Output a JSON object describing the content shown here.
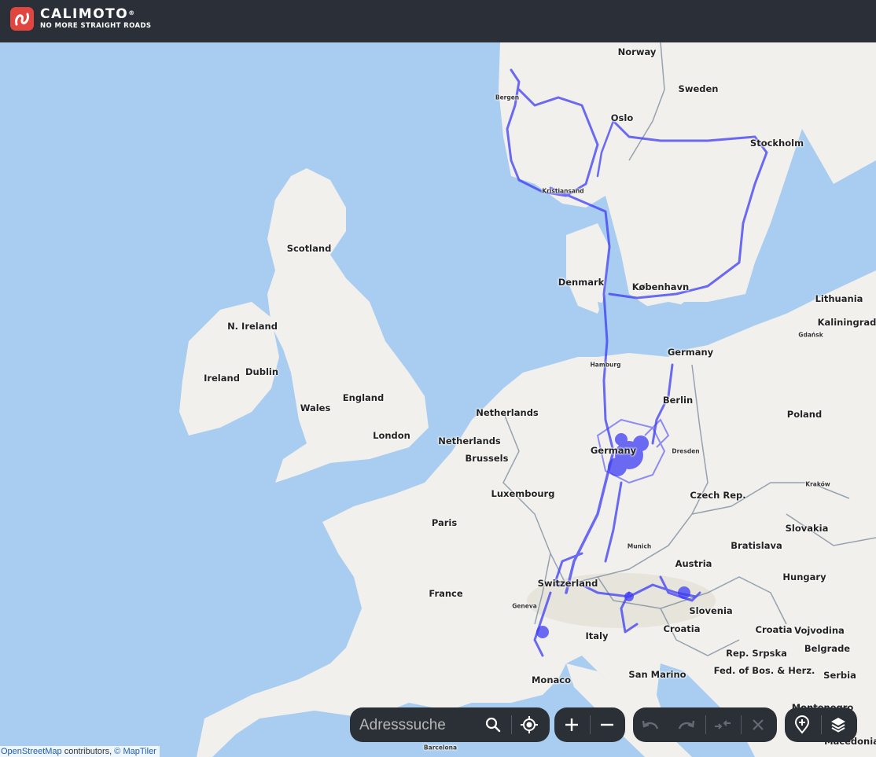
{
  "header": {
    "brand": "CALIMOTO",
    "registered": "®",
    "tagline": "NO MORE STRAIGHT ROADS"
  },
  "map": {
    "labels": {
      "norway": "Norway",
      "sweden": "Sweden",
      "bergen": "Bergen",
      "oslo": "Oslo",
      "stockholm": "Stockholm",
      "kristiansand": "Kristiansand",
      "scotland": "Scotland",
      "denmark": "Denmark",
      "kobenhavn": "København",
      "lithuania": "Lithuania",
      "kaliningrad": "Kaliningrad",
      "gdansk": "Gdańsk",
      "n_ireland": "N. Ireland",
      "dublin": "Dublin",
      "ireland": "Ireland",
      "england": "England",
      "wales": "Wales",
      "london": "London",
      "hamburg": "Hamburg",
      "germany_north": "Germany",
      "berlin": "Berlin",
      "netherlands_1": "Netherlands",
      "netherlands_2": "Netherlands",
      "brussels": "Brussels",
      "poland": "Poland",
      "germany_center": "Germany",
      "dresden": "Dresden",
      "krakow": "Kraków",
      "luxembourg": "Luxembourg",
      "czech_rep": "Czech Rep.",
      "paris": "Paris",
      "slovakia": "Slovakia",
      "munich": "Munich",
      "bratislava": "Bratislava",
      "austria": "Austria",
      "hungary": "Hungary",
      "switzerland": "Switzerland",
      "france": "France",
      "geneva": "Geneva",
      "slovenia": "Slovenia",
      "croatia_1": "Croatia",
      "croatia_2": "Croatia",
      "vojvodina": "Vojvodina",
      "italy": "Italy",
      "rep_srpska": "Rep. Srpska",
      "belgrade": "Belgrade",
      "fed_bos_herz": "Fed. of Bos. & Herz.",
      "serbia": "Serbia",
      "monaco": "Monaco",
      "san_marino": "San Marino",
      "montenegro": "Montenegro",
      "macedonia": "Macedonia",
      "barcelona": "Barcelona"
    },
    "colors": {
      "water": "#a8cdf0",
      "land": "#f2f0ec",
      "route": "#3d3cf5"
    }
  },
  "attribution": {
    "osm": "OpenStreetMap",
    "contributors": " contributors, ",
    "copyright": "©",
    "maptiler": "MapTiler"
  },
  "controls": {
    "search_placeholder": "Adresssuche",
    "icons": [
      "search-icon",
      "locate-icon",
      "zoom-in-icon",
      "zoom-out-icon",
      "undo-icon",
      "redo-icon",
      "reverse-route-icon",
      "clear-icon",
      "add-waypoint-icon",
      "layers-icon"
    ]
  }
}
